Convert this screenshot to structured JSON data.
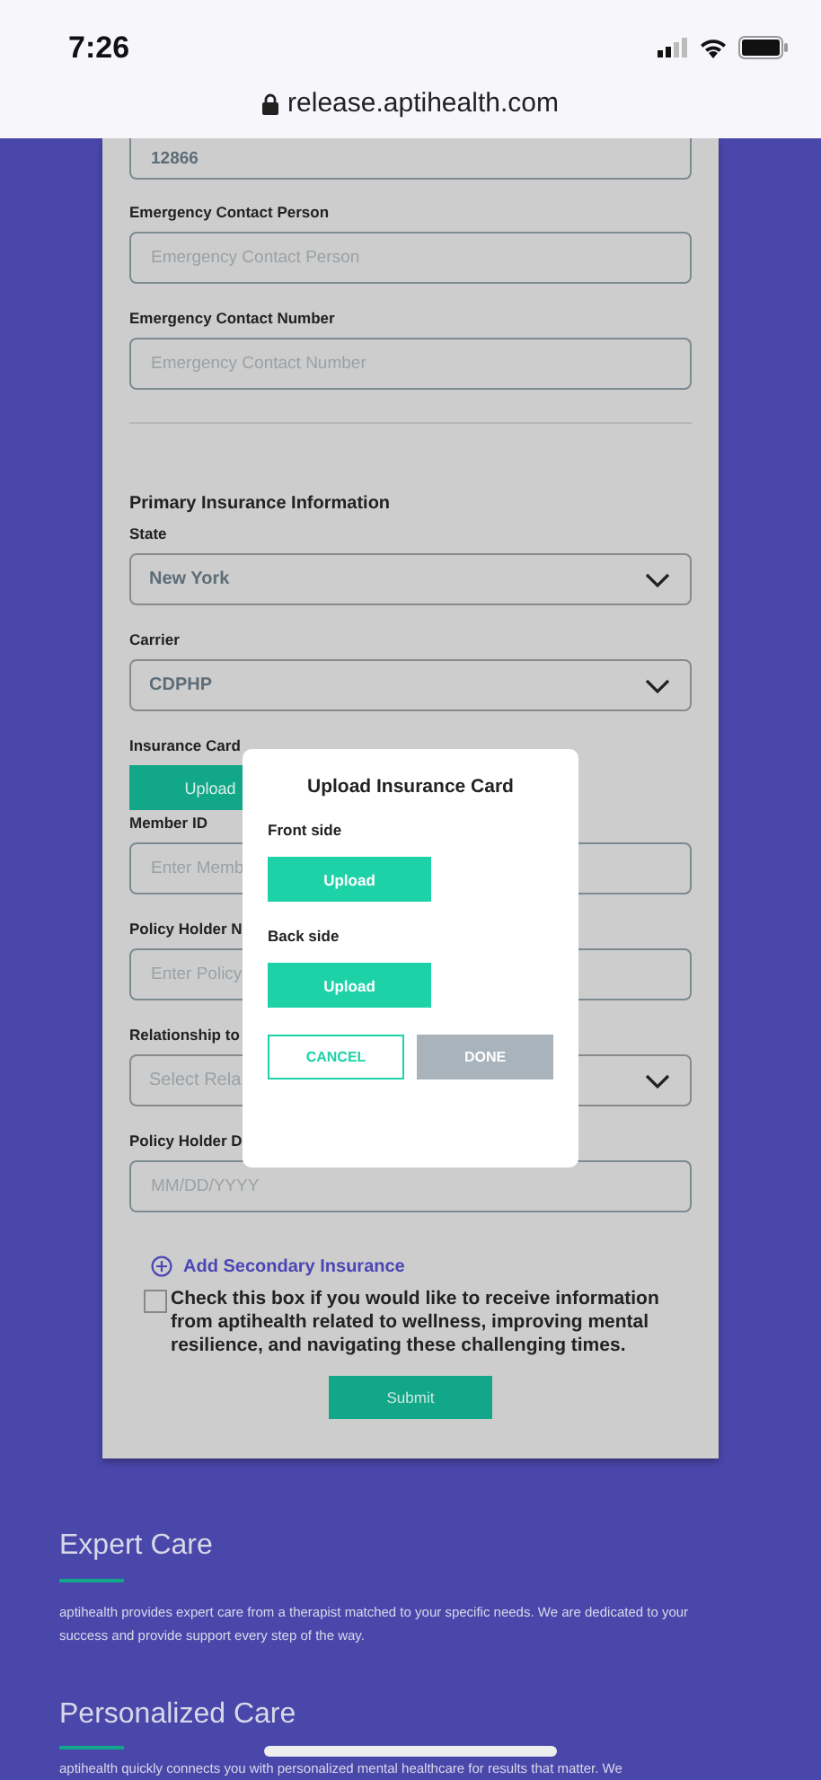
{
  "status_bar": {
    "time": "7:26"
  },
  "browser": {
    "url": "release.aptihealth.com"
  },
  "form": {
    "top_field": {
      "value": "12866"
    },
    "contact_fields": [
      {
        "label": "Emergency Contact Person",
        "placeholder": "Emergency Contact Person"
      },
      {
        "label": "Emergency Contact Number",
        "placeholder": "Emergency Contact Number"
      }
    ],
    "section_title": "Primary Insurance Information",
    "insurance_fields": [
      {
        "kind": "select",
        "label": "State",
        "value": "New York"
      },
      {
        "kind": "select",
        "label": "Carrier",
        "value": "CDPHP"
      },
      {
        "kind": "upload",
        "label": "Insurance Card",
        "button": "Upload"
      },
      {
        "kind": "input",
        "label": "Member ID",
        "placeholder": "Enter Memb"
      },
      {
        "kind": "input",
        "label": "Policy Holder N",
        "placeholder": "Enter Policy"
      },
      {
        "kind": "select",
        "label": "Relationship to",
        "placeholder": "Select Rela"
      },
      {
        "kind": "input",
        "label": "Policy Holder D",
        "placeholder": "MM/DD/YYYY"
      }
    ],
    "add_link": "Add Secondary Insurance",
    "consent": {
      "checked": false,
      "text": "Check this box if you would like to receive information from aptihealth related to wellness, improving mental resilience, and navigating these challenging times."
    },
    "submit": "Submit"
  },
  "modal": {
    "title": "Upload Insurance Card",
    "sides": [
      {
        "label": "Front side",
        "button": "Upload"
      },
      {
        "label": "Back side",
        "button": "Upload"
      }
    ],
    "cancel": "CANCEL",
    "done": {
      "label": "DONE",
      "disabled": true
    }
  },
  "features": [
    {
      "title": "Expert Care",
      "text": "aptihealth provides expert care from a therapist matched to your specific needs. We are dedicated to your success and provide support every step of the way."
    },
    {
      "title": "Personalized Care",
      "text": "aptihealth quickly connects you with personalized mental healthcare for results that matter. We"
    }
  ]
}
